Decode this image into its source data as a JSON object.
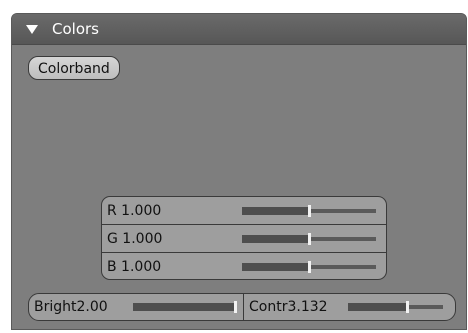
{
  "panel": {
    "title": "Colors",
    "colorband_label": "Colorband"
  },
  "rgb": [
    {
      "label": "R 1.000",
      "fraction": 0.5
    },
    {
      "label": "G 1.000",
      "fraction": 0.5
    },
    {
      "label": "B 1.000",
      "fraction": 0.5
    }
  ],
  "bright": {
    "label": "Bright2.00",
    "fraction": 1.0
  },
  "contr": {
    "label": "Contr3.132",
    "fraction": 0.63
  }
}
